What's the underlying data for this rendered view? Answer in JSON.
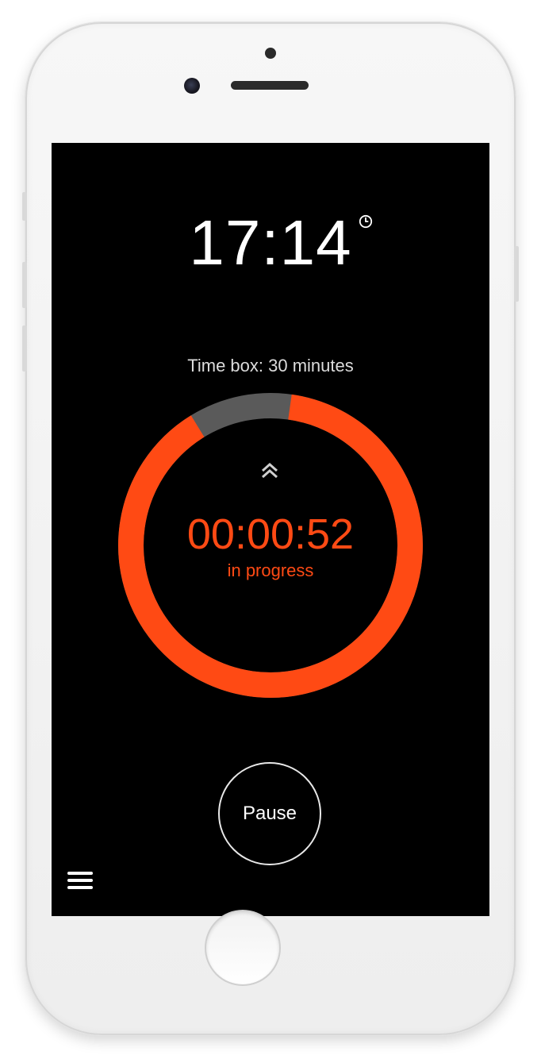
{
  "status_bar": {
    "time": "17:14"
  },
  "timer": {
    "timebox_label": "Time box: 30 minutes",
    "elapsed": "00:00:52",
    "status": "in progress",
    "progress_fraction": 0.89
  },
  "controls": {
    "pause_label": "Pause"
  },
  "icons": {
    "alarm": "alarm-clock-icon",
    "chevron": "double-chevron-up-icon",
    "menu": "hamburger-menu-icon"
  },
  "colors": {
    "accent": "#ff4a14",
    "track": "#5a5a5a",
    "screen_bg": "#000000"
  }
}
